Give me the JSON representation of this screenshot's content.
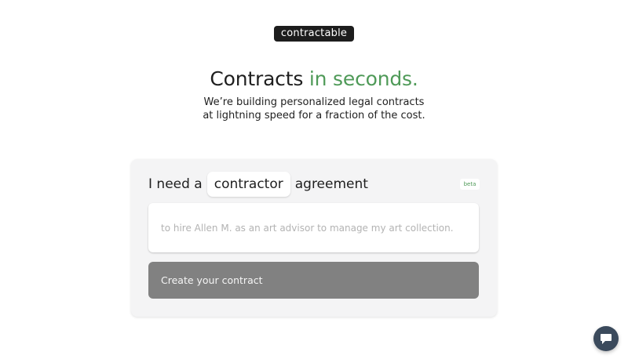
{
  "brand": {
    "logo_text": "contractable"
  },
  "hero": {
    "headline_main": "Contracts",
    "headline_accent": "in seconds.",
    "subtitle_line1": "We’re building personalized legal contracts",
    "subtitle_line2": "at lightning speed for a fraction of the cost."
  },
  "form": {
    "prefix": "I need a",
    "agreement_type": "contractor",
    "suffix": "agreement",
    "badge": "beta",
    "description_placeholder": "to hire Allen M. as an art advisor to manage my art collection.",
    "description_value": "",
    "submit_label": "Create your contract"
  },
  "chat": {
    "icon": "chat-bubble-icon"
  },
  "colors": {
    "accent": "#4f9a58",
    "logo_bg": "#1d1d1d",
    "card_bg": "#f4f4f5",
    "button_bg": "#818181",
    "chat_bg": "#3b4a5c"
  }
}
